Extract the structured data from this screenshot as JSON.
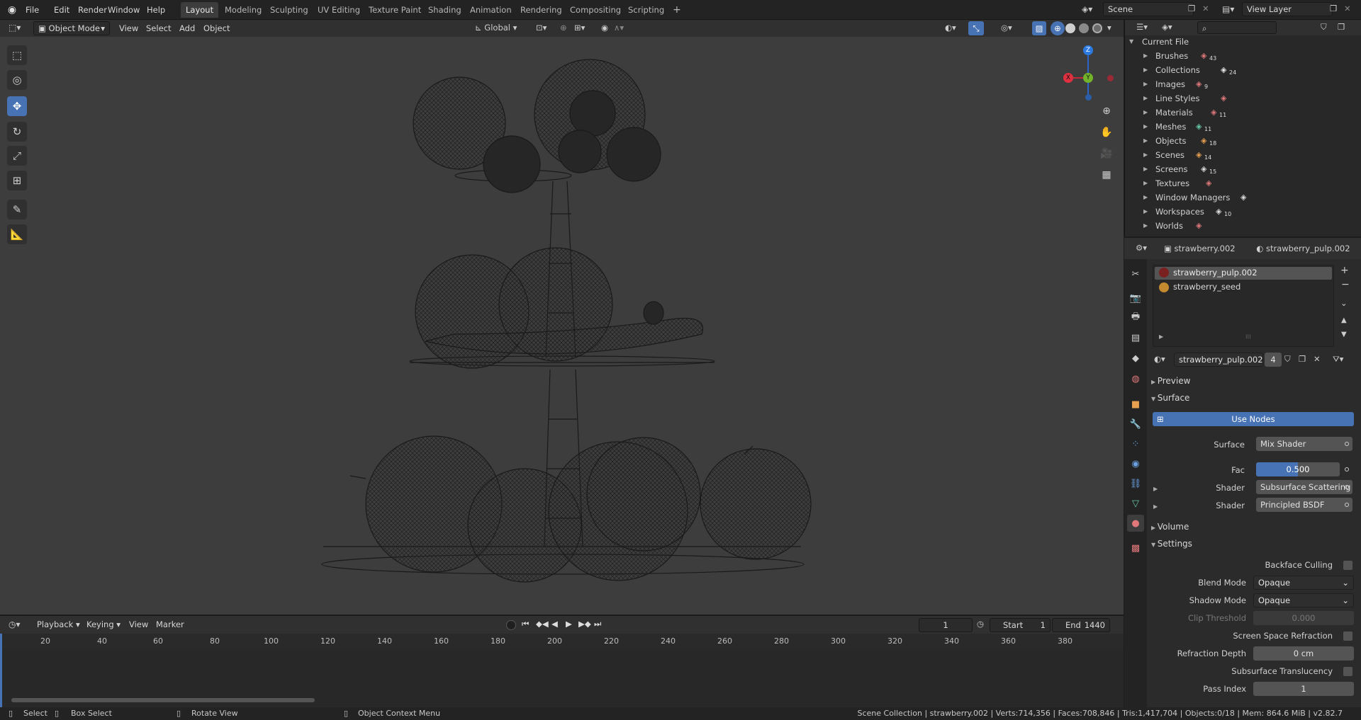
{
  "topbar": {
    "menus": [
      "File",
      "Edit",
      "Render",
      "Window",
      "Help"
    ],
    "workspaces": [
      "Layout",
      "Modeling",
      "Sculpting",
      "UV Editing",
      "Texture Paint",
      "Shading",
      "Animation",
      "Rendering",
      "Compositing",
      "Scripting"
    ],
    "active_workspace": "Layout",
    "add_tab": "+",
    "scene": "Scene",
    "view_layer": "View Layer"
  },
  "viewport_header": {
    "mode": "Object Mode",
    "menus": [
      "View",
      "Select",
      "Add",
      "Object"
    ],
    "orientation": "Global"
  },
  "gizmo": {
    "z": "Z",
    "y": "Y",
    "x": "X"
  },
  "timeline": {
    "menus": [
      "Playback",
      "Keying",
      "View",
      "Marker"
    ],
    "current_frame": "1",
    "start_label": "Start",
    "start": "1",
    "end_label": "End",
    "end": "1440",
    "ticks": [
      "20",
      "40",
      "60",
      "80",
      "100",
      "120",
      "140",
      "160",
      "180",
      "200",
      "220",
      "240",
      "260",
      "280",
      "300",
      "320",
      "340",
      "360",
      "380"
    ]
  },
  "statusbar": {
    "select": "Select",
    "box_select": "Box Select",
    "rotate_view": "Rotate View",
    "context_menu": "Object Context Menu",
    "stats": "Scene Collection | strawberry.002 | Verts:714,356 | Faces:708,846 | Tris:1,417,704 | Objects:0/18 | Mem: 864.6 MiB | v2.82.7"
  },
  "outliner": {
    "root": "Current File",
    "items": [
      {
        "label": "Brushes",
        "count": "43",
        "color": "#e0787a"
      },
      {
        "label": "Collections",
        "count": "24",
        "color": "#e8e8e8"
      },
      {
        "label": "Images",
        "count": "9",
        "color": "#e0787a"
      },
      {
        "label": "Line Styles",
        "count": "",
        "color": "#e07a7a"
      },
      {
        "label": "Materials",
        "count": "11",
        "color": "#e0787a"
      },
      {
        "label": "Meshes",
        "count": "11",
        "color": "#67c7a8"
      },
      {
        "label": "Objects",
        "count": "18",
        "color": "#e8a050"
      },
      {
        "label": "Scenes",
        "count": "14",
        "color": "#e8a050"
      },
      {
        "label": "Screens",
        "count": "15",
        "color": "#dddddd"
      },
      {
        "label": "Textures",
        "count": "",
        "color": "#e07a7a"
      },
      {
        "label": "Window Managers",
        "count": "",
        "color": "#dddddd"
      },
      {
        "label": "Workspaces",
        "count": "10",
        "color": "#dddddd"
      },
      {
        "label": "Worlds",
        "count": "",
        "color": "#e0787a"
      }
    ]
  },
  "properties": {
    "object_name": "strawberry.002",
    "material_name": "strawberry_pulp.002",
    "slots": [
      "strawberry_pulp.002",
      "strawberry_seed"
    ],
    "material_field": "strawberry_pulp.002",
    "users": "4",
    "sections": {
      "preview": "Preview",
      "surface": "Surface",
      "volume": "Volume",
      "settings": "Settings"
    },
    "use_nodes": "Use Nodes",
    "surface_label": "Surface",
    "surface_value": "Mix Shader",
    "fac_label": "Fac",
    "fac_value": "0.500",
    "fac_fraction": 0.5,
    "shader_label": "Shader",
    "shader1": "Subsurface Scattering",
    "shader2": "Principled BSDF",
    "settings": {
      "backface_culling": "Backface Culling",
      "blend_mode_label": "Blend Mode",
      "blend_mode": "Opaque",
      "shadow_mode_label": "Shadow Mode",
      "shadow_mode": "Opaque",
      "clip_threshold_label": "Clip Threshold",
      "clip_threshold": "0.000",
      "ssr_label": "Screen Space Refraction",
      "refraction_depth_label": "Refraction Depth",
      "refraction_depth": "0 cm",
      "sss_translucency_label": "Subsurface Translucency",
      "pass_index_label": "Pass Index",
      "pass_index": "1"
    }
  },
  "colors": {
    "accent": "#4772b3",
    "header": "#303030",
    "viewport": "#3d3d3d"
  }
}
